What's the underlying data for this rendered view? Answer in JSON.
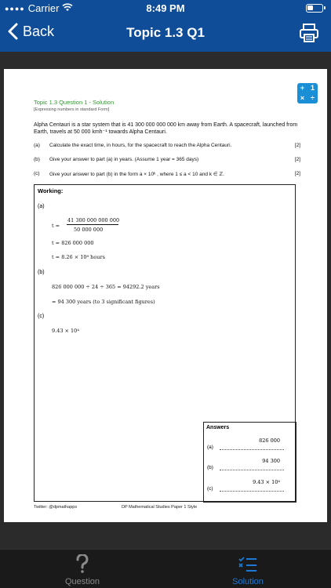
{
  "status": {
    "carrier": "Carrier",
    "time": "8:49 PM",
    "battery_level": 0.4
  },
  "nav": {
    "back_label": "Back",
    "title": "Topic 1.3 Q1",
    "print_icon": "printer-icon"
  },
  "doc": {
    "logo": [
      "+",
      "1",
      "×",
      "÷"
    ],
    "title": "Topic 1.3 Question 1 - Solution",
    "subtitle": "[Expressing numbers in standard Form]",
    "intro": "Alpha Centauri is a star system that is 41 300 000 000 000 km away from Earth. A spacecraft, launched from Earth, travels at 50 000 kmh⁻¹ towards Alpha Centauri.",
    "questions": [
      {
        "label": "(a)",
        "text": "Calculate the exact time, in hours, for the spacecraft to reach the Alpha Centauri.",
        "marks": "[2]"
      },
      {
        "label": "(b)",
        "text": "Give your answer to part (a) in years. (Assume 1 year = 365 days)",
        "marks": "[2]"
      },
      {
        "label": "(c)",
        "text": "Give your answer to part (b) in the form a × 10ᵏ , where 1 ≤ a < 10 and k ∈ ℤ.",
        "marks": "[2]"
      }
    ],
    "working": {
      "heading": "Working:",
      "part_a": "(a)",
      "t_eq": "t =",
      "numerator": "41 300 000 000 000",
      "denominator": "50 000 000",
      "line2": "t = 826 000 000",
      "line3": "t = 8.26 × 10⁸ hours",
      "part_b": "(b)",
      "line4": "826 000 000 ÷ 24 ÷ 365 = 94292.2 years",
      "line5": "= 94 300 years (to 3 significant figures)",
      "part_c": "(c)",
      "line6": "9.43 × 10⁴"
    },
    "answers": {
      "heading": "Answers",
      "items": [
        {
          "label": "(a)",
          "value": "826 000"
        },
        {
          "label": "(b)",
          "value": "94 300"
        },
        {
          "label": "(c)",
          "value": "9.43 × 10⁴"
        }
      ]
    },
    "footer_left": "Twitter: @dpmathapps",
    "footer_mid": "DP Mathematical Studies Paper 1 Style"
  },
  "tabs": [
    {
      "label": "Question",
      "icon": "question-mark-icon"
    },
    {
      "label": "Solution",
      "icon": "checklist-icon"
    }
  ],
  "colors": {
    "nav_bg": "#0f4d99",
    "title_green": "#2c9a2c",
    "tab_active": "#1f78d1",
    "tab_inactive": "#8a8a8a"
  }
}
